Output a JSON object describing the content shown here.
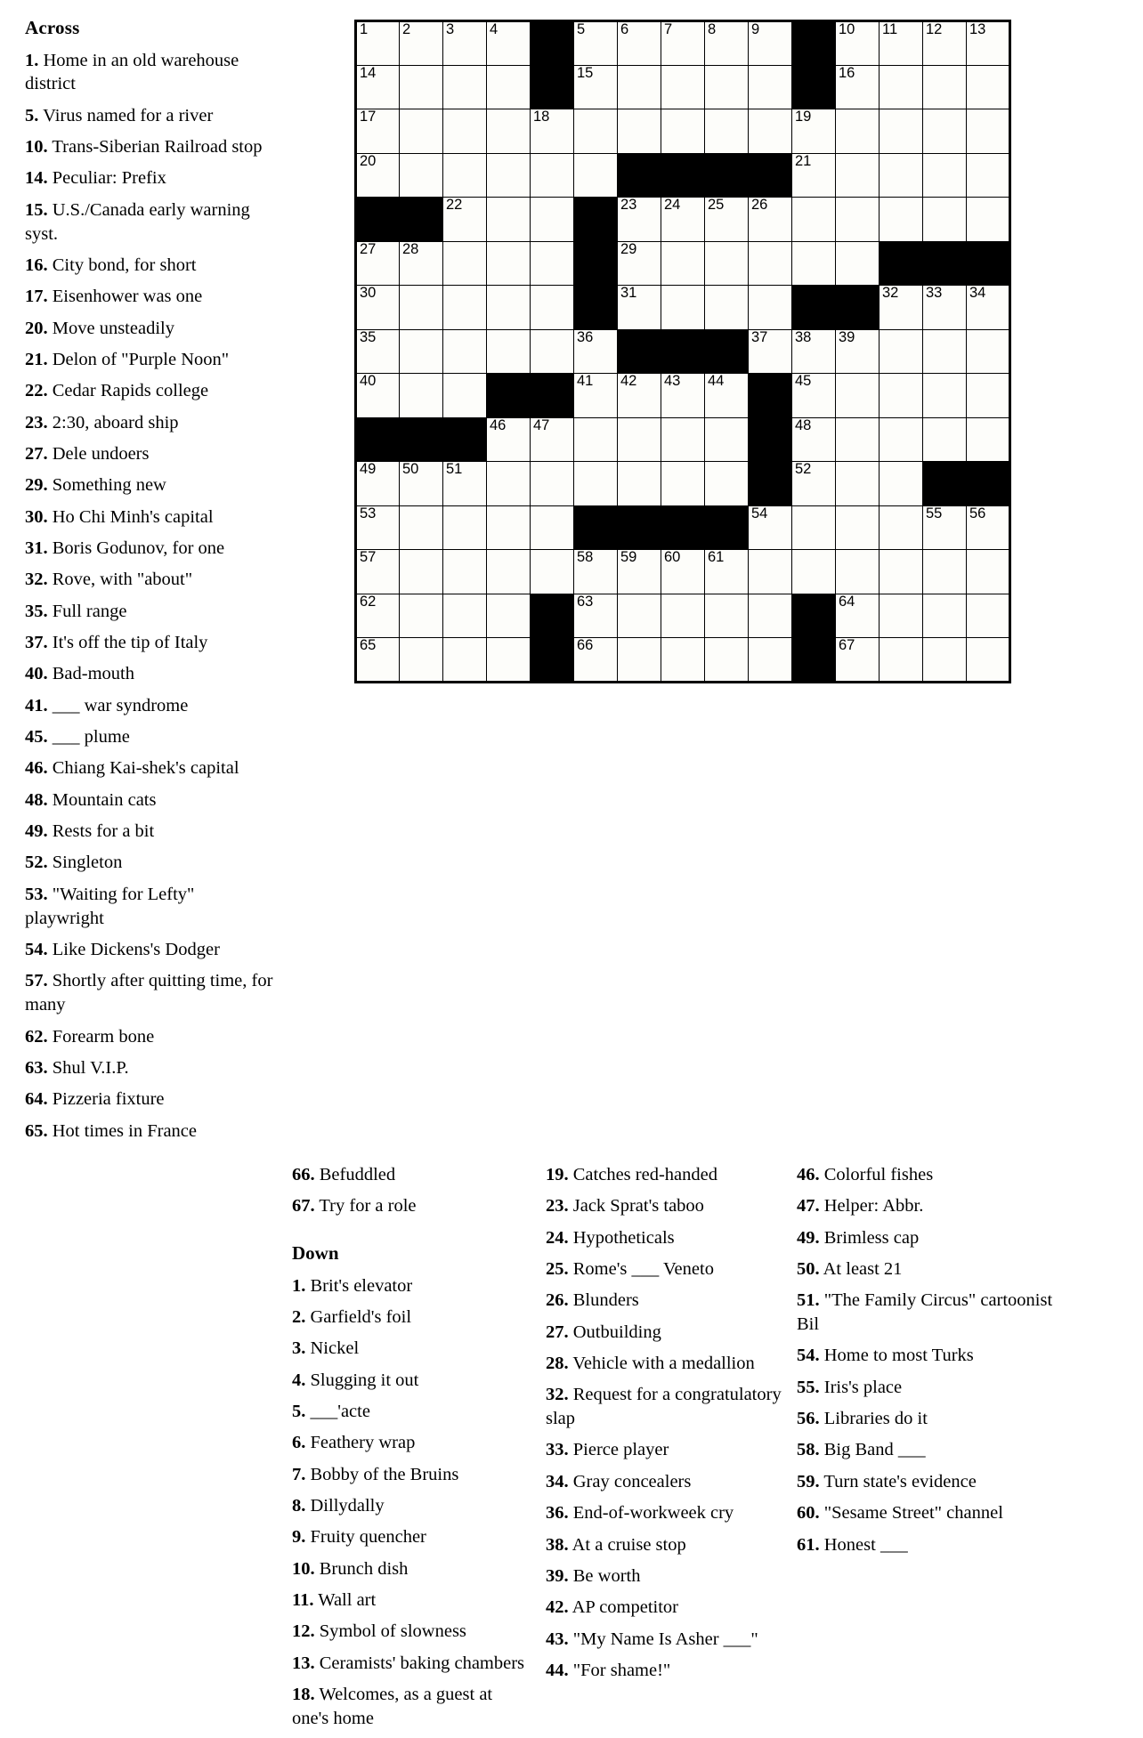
{
  "headings": {
    "across": "Across",
    "down": "Down"
  },
  "across_col1": [
    {
      "num": "1.",
      "text": "Home in an old warehouse district"
    },
    {
      "num": "5.",
      "text": "Virus named for a river"
    },
    {
      "num": "10.",
      "text": "Trans-Siberian Railroad stop"
    },
    {
      "num": "14.",
      "text": "Peculiar: Prefix"
    },
    {
      "num": "15.",
      "text": "U.S./Canada early warning syst."
    },
    {
      "num": "16.",
      "text": "City bond, for short"
    },
    {
      "num": "17.",
      "text": "Eisenhower was one"
    },
    {
      "num": "20.",
      "text": "Move unsteadily"
    },
    {
      "num": "21.",
      "text": "Delon of \"Purple Noon\""
    },
    {
      "num": "22.",
      "text": "Cedar Rapids college"
    },
    {
      "num": "23.",
      "text": "2:30, aboard ship"
    },
    {
      "num": "27.",
      "text": "Dele undoers"
    },
    {
      "num": "29.",
      "text": "Something new"
    },
    {
      "num": "30.",
      "text": "Ho Chi Minh's capital"
    },
    {
      "num": "31.",
      "text": "Boris Godunov, for one"
    },
    {
      "num": "32.",
      "text": "Rove, with \"about\""
    },
    {
      "num": "35.",
      "text": "Full range"
    },
    {
      "num": "37.",
      "text": "It's off the tip of Italy"
    },
    {
      "num": "40.",
      "text": "Bad-mouth"
    },
    {
      "num": "41.",
      "text": "___ war syndrome"
    },
    {
      "num": "45.",
      "text": "___ plume"
    },
    {
      "num": "46.",
      "text": "Chiang Kai-shek's capital"
    },
    {
      "num": "48.",
      "text": "Mountain cats"
    },
    {
      "num": "49.",
      "text": "Rests for a bit"
    },
    {
      "num": "52.",
      "text": "Singleton"
    },
    {
      "num": "53.",
      "text": "\"Waiting for Lefty\" playwright"
    },
    {
      "num": "54.",
      "text": "Like Dickens's Dodger"
    },
    {
      "num": "57.",
      "text": "Shortly after quitting time, for many"
    },
    {
      "num": "62.",
      "text": "Forearm bone"
    },
    {
      "num": "63.",
      "text": "Shul V.I.P."
    },
    {
      "num": "64.",
      "text": "Pizzeria fixture"
    },
    {
      "num": "65.",
      "text": "Hot times in France"
    }
  ],
  "across_col2": [
    {
      "num": "66.",
      "text": "Befuddled"
    },
    {
      "num": "67.",
      "text": "Try for a role"
    }
  ],
  "down_col2": [
    {
      "num": "1.",
      "text": "Brit's elevator"
    },
    {
      "num": "2.",
      "text": "Garfield's foil"
    },
    {
      "num": "3.",
      "text": "Nickel"
    },
    {
      "num": "4.",
      "text": "Slugging it out"
    },
    {
      "num": "5.",
      "text": "___'acte"
    },
    {
      "num": "6.",
      "text": "Feathery wrap"
    },
    {
      "num": "7.",
      "text": "Bobby of the Bruins"
    },
    {
      "num": "8.",
      "text": "Dillydally"
    },
    {
      "num": "9.",
      "text": "Fruity quencher"
    },
    {
      "num": "10.",
      "text": "Brunch dish"
    },
    {
      "num": "11.",
      "text": "Wall art"
    },
    {
      "num": "12.",
      "text": "Symbol of slowness"
    },
    {
      "num": "13.",
      "text": "Ceramists' baking chambers"
    },
    {
      "num": "18.",
      "text": "Welcomes, as a guest at one's home"
    }
  ],
  "down_col3": [
    {
      "num": "19.",
      "text": "Catches red-handed"
    },
    {
      "num": "23.",
      "text": "Jack Sprat's taboo"
    },
    {
      "num": "24.",
      "text": "Hypotheticals"
    },
    {
      "num": "25.",
      "text": "Rome's ___ Veneto"
    },
    {
      "num": "26.",
      "text": "Blunders"
    },
    {
      "num": "27.",
      "text": "Outbuilding"
    },
    {
      "num": "28.",
      "text": "Vehicle with a medallion"
    },
    {
      "num": "32.",
      "text": "Request for a congratulatory slap"
    },
    {
      "num": "33.",
      "text": "Pierce player"
    },
    {
      "num": "34.",
      "text": "Gray concealers"
    },
    {
      "num": "36.",
      "text": "End-of-workweek cry"
    },
    {
      "num": "38.",
      "text": "At a cruise stop"
    },
    {
      "num": "39.",
      "text": "Be worth"
    },
    {
      "num": "42.",
      "text": "AP competitor"
    },
    {
      "num": "43.",
      "text": "\"My Name Is Asher ___\""
    },
    {
      "num": "44.",
      "text": "\"For shame!\""
    }
  ],
  "down_col4": [
    {
      "num": "46.",
      "text": "Colorful fishes"
    },
    {
      "num": "47.",
      "text": "Helper: Abbr."
    },
    {
      "num": "49.",
      "text": "Brimless cap"
    },
    {
      "num": "50.",
      "text": "At least 21"
    },
    {
      "num": "51.",
      "text": "\"The Family Circus\" cartoonist Bil"
    },
    {
      "num": "54.",
      "text": "Home to most Turks"
    },
    {
      "num": "55.",
      "text": "Iris's place"
    },
    {
      "num": "56.",
      "text": "Libraries do it"
    },
    {
      "num": "58.",
      "text": "Big Band ___"
    },
    {
      "num": "59.",
      "text": "Turn state's evidence"
    },
    {
      "num": "60.",
      "text": "\"Sesame Street\" channel"
    },
    {
      "num": "61.",
      "text": "Honest ___"
    }
  ],
  "grid": {
    "rows": 15,
    "cols": 15,
    "colors": {
      "block": "#000000",
      "cell": "#fdfdfa",
      "line": "#000000"
    },
    "cells": [
      [
        {
          "n": "1"
        },
        {
          "n": "2"
        },
        {
          "n": "3"
        },
        {
          "n": "4"
        },
        {
          "b": 1
        },
        {
          "n": "5"
        },
        {
          "n": "6"
        },
        {
          "n": "7"
        },
        {
          "n": "8"
        },
        {
          "n": "9"
        },
        {
          "b": 1
        },
        {
          "n": "10"
        },
        {
          "n": "11"
        },
        {
          "n": "12"
        },
        {
          "n": "13"
        }
      ],
      [
        {
          "n": "14"
        },
        {},
        {},
        {},
        {
          "b": 1
        },
        {
          "n": "15"
        },
        {},
        {},
        {},
        {},
        {
          "b": 1
        },
        {
          "n": "16"
        },
        {},
        {},
        {}
      ],
      [
        {
          "n": "17"
        },
        {},
        {},
        {},
        {
          "n": "18"
        },
        {},
        {},
        {},
        {},
        {},
        {
          "n": "19"
        },
        {},
        {},
        {},
        {}
      ],
      [
        {
          "n": "20"
        },
        {},
        {},
        {},
        {},
        {},
        {
          "b": 1
        },
        {
          "b": 1
        },
        {
          "b": 1
        },
        {
          "b": 1
        },
        {
          "n": "21"
        },
        {},
        {},
        {},
        {}
      ],
      [
        {
          "b": 1
        },
        {
          "b": 1
        },
        {
          "n": "22"
        },
        {},
        {},
        {
          "b": 1
        },
        {
          "n": "23"
        },
        {
          "n": "24"
        },
        {
          "n": "25"
        },
        {
          "n": "26"
        },
        {},
        {},
        {},
        {},
        {}
      ],
      [
        {
          "n": "27"
        },
        {
          "n": "28"
        },
        {},
        {},
        {},
        {
          "b": 1
        },
        {
          "n": "29"
        },
        {},
        {},
        {},
        {},
        {},
        {
          "b": 1
        },
        {
          "b": 1
        },
        {
          "b": 1
        }
      ],
      [
        {
          "n": "30"
        },
        {},
        {},
        {},
        {},
        {
          "b": 1
        },
        {
          "n": "31"
        },
        {},
        {},
        {},
        {
          "b": 1
        },
        {
          "b": 1
        },
        {
          "n": "32"
        },
        {
          "n": "33"
        },
        {
          "n": "34"
        }
      ],
      [
        {
          "n": "35"
        },
        {},
        {},
        {},
        {},
        {
          "n": "36"
        },
        {
          "b": 1
        },
        {
          "b": 1
        },
        {
          "b": 1
        },
        {
          "n": "37"
        },
        {
          "n": "38"
        },
        {
          "n": "39"
        },
        {},
        {},
        {}
      ],
      [
        {
          "n": "40"
        },
        {},
        {},
        {
          "b": 1
        },
        {
          "b": 1
        },
        {
          "n": "41"
        },
        {
          "n": "42"
        },
        {
          "n": "43"
        },
        {
          "n": "44"
        },
        {
          "b": 1
        },
        {
          "n": "45"
        },
        {},
        {},
        {},
        {}
      ],
      [
        {
          "b": 1
        },
        {
          "b": 1
        },
        {
          "b": 1
        },
        {
          "n": "46"
        },
        {
          "n": "47"
        },
        {},
        {},
        {},
        {},
        {
          "b": 1
        },
        {
          "n": "48"
        },
        {},
        {},
        {},
        {}
      ],
      [
        {
          "n": "49"
        },
        {
          "n": "50"
        },
        {
          "n": "51"
        },
        {},
        {},
        {},
        {},
        {},
        {},
        {
          "b": 1
        },
        {
          "n": "52"
        },
        {},
        {},
        {
          "b": 1
        },
        {
          "b": 1
        }
      ],
      [
        {
          "n": "53"
        },
        {},
        {},
        {},
        {},
        {
          "b": 1
        },
        {
          "b": 1
        },
        {
          "b": 1
        },
        {
          "b": 1
        },
        {
          "n": "54"
        },
        {},
        {},
        {},
        {
          "n": "55"
        },
        {
          "n": "56"
        }
      ],
      [
        {
          "n": "57"
        },
        {},
        {},
        {},
        {},
        {
          "n": "58"
        },
        {
          "n": "59"
        },
        {
          "n": "60"
        },
        {
          "n": "61"
        },
        {},
        {},
        {},
        {},
        {},
        {}
      ],
      [
        {
          "n": "62"
        },
        {},
        {},
        {},
        {
          "b": 1
        },
        {
          "n": "63"
        },
        {},
        {},
        {},
        {},
        {
          "b": 1
        },
        {
          "n": "64"
        },
        {},
        {},
        {}
      ],
      [
        {
          "n": "65"
        },
        {},
        {},
        {},
        {
          "b": 1
        },
        {
          "n": "66"
        },
        {},
        {},
        {},
        {},
        {
          "b": 1
        },
        {
          "n": "67"
        },
        {},
        {},
        {}
      ]
    ]
  }
}
